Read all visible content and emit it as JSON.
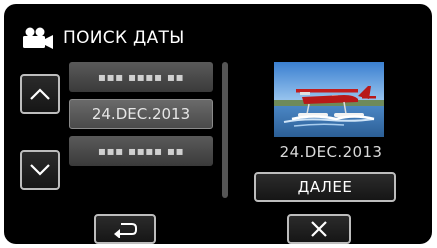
{
  "header": {
    "title": "ПОИСК ДАТЫ",
    "icon": "video-camera-icon"
  },
  "date_list": {
    "rows": [
      {
        "label": "▪▪▪ ▪▪▪▪ ▪▪",
        "state": "dim"
      },
      {
        "label": "24.DEC.2013",
        "state": "selected"
      },
      {
        "label": "▪▪▪ ▪▪▪▪ ▪▪",
        "state": "dim"
      }
    ]
  },
  "preview": {
    "date": "24.DEC.2013",
    "image": "seaplane-thumbnail"
  },
  "buttons": {
    "up_icon": "chevron-up-icon",
    "down_icon": "chevron-down-icon",
    "next_label": "ДАЛЕЕ",
    "back_icon": "return-arrow-icon",
    "close_icon": "close-icon"
  },
  "colors": {
    "background": "#000000",
    "button_border": "#bdbdbd",
    "text": "#ffffff"
  }
}
